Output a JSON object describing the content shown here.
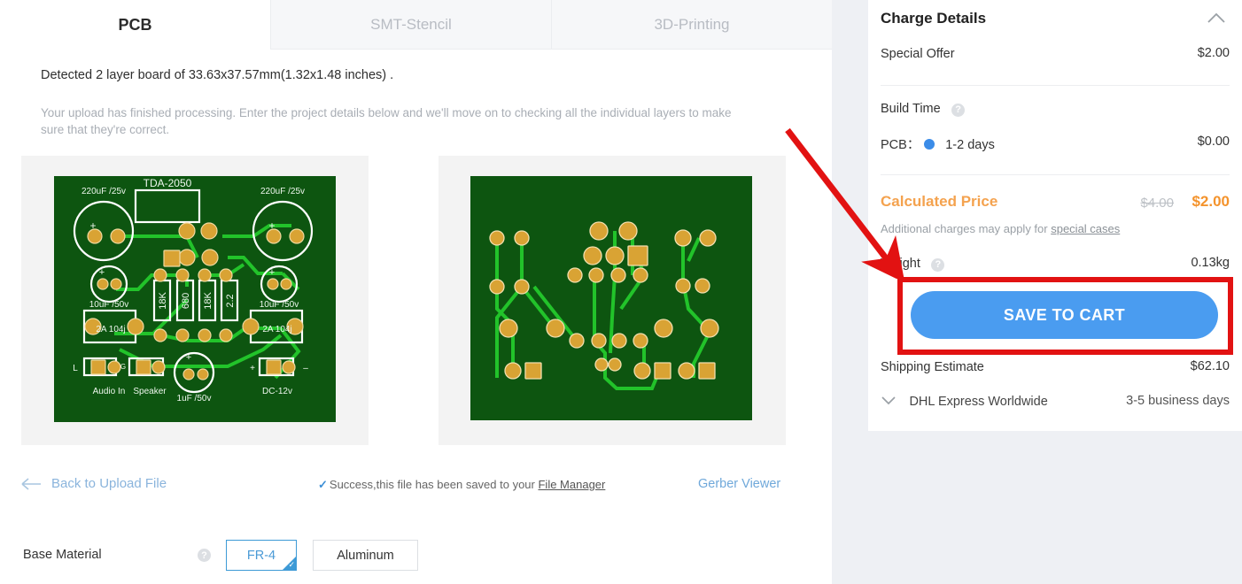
{
  "tabs": [
    {
      "label": "PCB",
      "active": true
    },
    {
      "label": "SMT-Stencil",
      "active": false
    },
    {
      "label": "3D-Printing",
      "active": false
    }
  ],
  "main": {
    "detected_text": "Detected 2 layer board of 33.63x37.57mm(1.32x1.48 inches) .",
    "hint_text": "Your upload has finished processing. Enter the project details below and we'll move on to checking all the individual layers to make sure that they're correct.",
    "back_link": "Back to Upload File",
    "success_prefix": "Success,this file has been saved to your ",
    "success_link": "File Manager",
    "gerber_viewer": "Gerber Viewer",
    "base_material_label": "Base Material",
    "base_material_options": [
      "FR-4",
      "Aluminum"
    ],
    "base_material_selected": "FR-4"
  },
  "pcb_silkscreen": {
    "labels": {
      "ic": "TDA-2050",
      "cap_tl": "220uF /25v",
      "cap_tr": "220uF /25v",
      "cap_ml": "10uF /50v",
      "cap_mr": "10uF /50v",
      "cap_bc": "1uF /50v",
      "res1": "18K",
      "res2": "680",
      "res3": "18K",
      "res4": "2.2",
      "box_l": "2A  104j",
      "box_r": "2A  104j",
      "audio_in": "Audio In",
      "speaker": "Speaker",
      "dc": "DC-12v",
      "pin_l": "L",
      "pin_g": "G",
      "pin_plus": "+",
      "pin_minus": "-"
    }
  },
  "panel": {
    "title": "Charge Details",
    "special_offer_label": "Special Offer",
    "special_offer_value": "$2.00",
    "build_time_label": "Build Time",
    "pcb_label": "PCB：",
    "pcb_build_days": "1-2 days",
    "pcb_build_value": "$0.00",
    "calculated_price_label": "Calculated Price",
    "price_old": "$4.00",
    "price_new": "$2.00",
    "note_prefix": "Additional charges may apply for ",
    "note_link": "special cases",
    "weight_label": "Weight",
    "weight_value": "0.13kg",
    "save_button": "SAVE TO CART",
    "shipping_label": "Shipping Estimate",
    "shipping_value": "$62.10",
    "carrier_label": "DHL Express Worldwide",
    "carrier_eta": "3-5 business days"
  },
  "colors": {
    "accent_blue": "#4a9cf0",
    "price_orange": "#f4932c",
    "annotation_red": "#e21212",
    "board_green": "#0d5510",
    "pad_gold": "#d9a334"
  },
  "annotation": {
    "arrow": "red-arrow-pointing-to-save-to-cart",
    "highlight": "red-rectangle-around-save-to-cart"
  }
}
